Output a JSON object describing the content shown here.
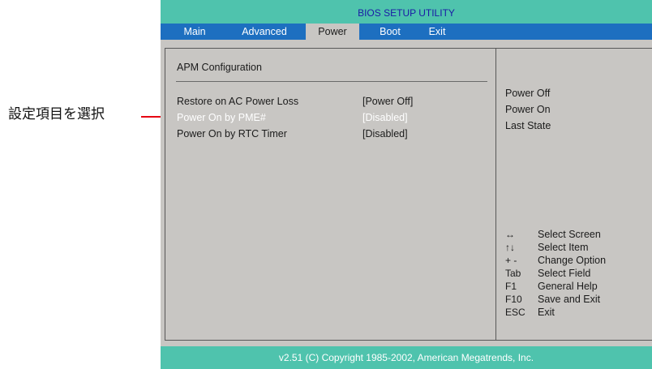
{
  "annotation": {
    "label": "設定項目を選択",
    "line_color": "#e60012"
  },
  "bios": {
    "title": "BIOS SETUP UTILITY",
    "menu": [
      {
        "label": "Main",
        "active": false
      },
      {
        "label": "Advanced",
        "active": false
      },
      {
        "label": "Power",
        "active": true
      },
      {
        "label": "Boot",
        "active": false
      },
      {
        "label": "Exit",
        "active": false
      }
    ],
    "section_title": "APM Configuration",
    "settings": [
      {
        "label": "Restore on AC Power Loss",
        "value": "[Power Off]",
        "selected": false
      },
      {
        "label": "Power On by PME#",
        "value": "[Disabled]",
        "selected": true
      },
      {
        "label": "Power On by RTC Timer",
        "value": "[Disabled]",
        "selected": false
      }
    ],
    "help_options": [
      "Power Off",
      "Power On",
      "Last State"
    ],
    "key_help": [
      {
        "key": "↔",
        "desc": "Select Screen"
      },
      {
        "key": "↑↓",
        "desc": "Select Item"
      },
      {
        "key": "+ -",
        "desc": "Change Option"
      },
      {
        "key": "Tab",
        "desc": "Select Field"
      },
      {
        "key": "F1",
        "desc": "General Help"
      },
      {
        "key": "F10",
        "desc": "Save and Exit"
      },
      {
        "key": "ESC",
        "desc": "Exit"
      }
    ],
    "footer": "v2.51 (C) Copyright 1985-2002, American Megatrends, Inc."
  },
  "colors": {
    "title_bar": "#4fc3ad",
    "menu_bar": "#1d6fc0",
    "panel_bg": "#c8c6c3",
    "title_text": "#1a1aa6",
    "highlight_text": "#ffffff"
  }
}
